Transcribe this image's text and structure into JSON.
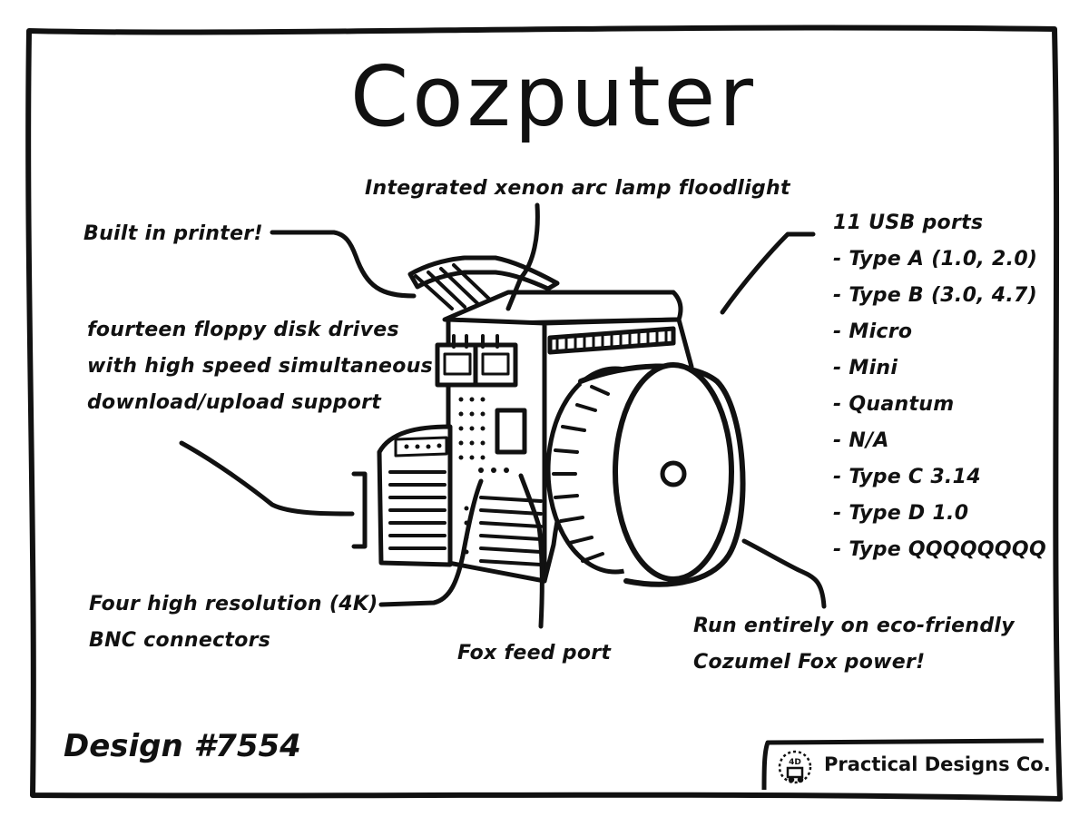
{
  "title": "Cozputer",
  "labels": {
    "floodlight": "Integrated xenon arc lamp floodlight",
    "printer": "Built in printer!",
    "floppy": [
      "fourteen floppy disk drives",
      "with high speed simultaneous",
      "download/upload support"
    ],
    "bnc": [
      "Four high resolution (4K)",
      "BNC connectors"
    ],
    "fox_port": "Fox feed port",
    "power": [
      "Run entirely on eco-friendly",
      "Cozumel Fox power!"
    ],
    "usb": [
      "11 USB ports",
      "- Type A (1.0, 2.0)",
      "- Type B (3.0, 4.7)",
      "- Micro",
      "- Mini",
      "- Quantum",
      "- N/A",
      "- Type C 3.14",
      "- Type D 1.0",
      "- Type QQQQQQQQ"
    ]
  },
  "design_number": "Design #7554",
  "company": {
    "name": "Practical Designs Co.",
    "logo_text": "4D",
    "logo_icon": "gear-clock-icon"
  },
  "colors": {
    "ink": "#111111",
    "paper": "#ffffff"
  }
}
